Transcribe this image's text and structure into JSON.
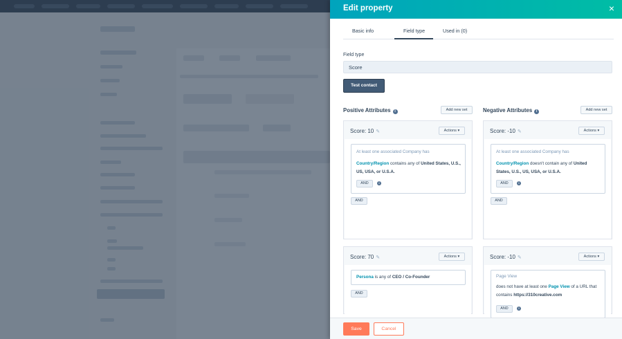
{
  "panel": {
    "title": "Edit property",
    "close_icon": "×"
  },
  "tabs": [
    {
      "label": "Basic info"
    },
    {
      "label": "Field type"
    },
    {
      "label": "Used in (0)"
    }
  ],
  "field": {
    "label": "Field type",
    "value": "Score"
  },
  "test_contact_label": "Test contact",
  "positive": {
    "title": "Positive Attributes",
    "add_label": "Add new set",
    "sets": [
      {
        "score": "Score: 10",
        "actions": "Actions ▾",
        "rule_header": "At least one associated Company has",
        "rule_link": "Country/Region",
        "rule_mid": " contains any of ",
        "rule_values": "United States, U.S., US, USA, or U.S.A.",
        "inner_and": "AND",
        "outer_and": "AND"
      },
      {
        "score": "Score: 70",
        "actions": "Actions ▾",
        "rule_link": "Persona",
        "rule_mid": " is any of ",
        "rule_values": "CEO / Co-Founder",
        "outer_and": "AND"
      }
    ]
  },
  "negative": {
    "title": "Negative Attributes",
    "add_label": "Add new set",
    "sets": [
      {
        "score": "Score: -10",
        "actions": "Actions ▾",
        "rule_header": "At least one associated Company has",
        "rule_link": "Country/Region",
        "rule_mid": " doesn't contain any of ",
        "rule_values": "United States, U.S., US, USA, or U.S.A.",
        "inner_and": "AND",
        "outer_and": "AND"
      },
      {
        "score": "Score: -10",
        "actions": "Actions ▾",
        "rule_header": "Page View",
        "rule_pre": "does not have at least one ",
        "rule_link": "Page View",
        "rule_mid": " of a URL that contains ",
        "rule_values": "https://310creative.com",
        "inner_and": "AND"
      }
    ]
  },
  "footer": {
    "save_label": "Save",
    "cancel_label": "Cancel"
  },
  "colors": {
    "header_start": "#00a4bd",
    "header_end": "#00bda5",
    "primary_dark": "#425b76",
    "accent_orange": "#ff7a59",
    "link": "#0091ae"
  }
}
